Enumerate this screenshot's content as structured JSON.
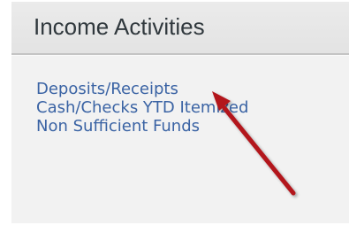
{
  "panel": {
    "title": "Income Activities",
    "links": [
      {
        "label": "Deposits/Receipts"
      },
      {
        "label": "Cash/Checks YTD Itemized"
      },
      {
        "label": "Non Sufficient Funds"
      }
    ]
  },
  "annotation": {
    "arrow_color": "#b3161b",
    "icon": "arrow-annotation-icon"
  }
}
